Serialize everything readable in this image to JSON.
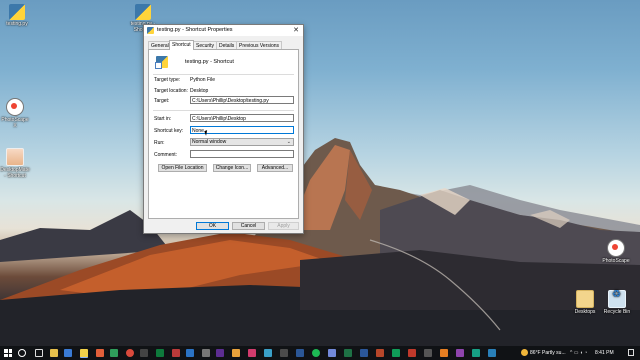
{
  "dialog": {
    "title": "testing.py - Shortcut Properties",
    "close_glyph": "✕",
    "tabs": [
      {
        "label": "General"
      },
      {
        "label": "Shortcut"
      },
      {
        "label": "Security"
      },
      {
        "label": "Details"
      },
      {
        "label": "Previous Versions"
      }
    ],
    "active_tab": "Shortcut",
    "shortcut_name": "testing.py - Shortcut",
    "target_type_label": "Target type:",
    "target_type_value": "Python File",
    "target_location_label": "Target location:",
    "target_location_value": "Desktop",
    "target_label": "Target:",
    "target_value": "C:\\Users\\Phillip\\Desktop\\testing.py",
    "start_in_label": "Start in:",
    "start_in_value": "C:\\Users\\Phillip\\Desktop",
    "shortcut_key_label": "Shortcut key:",
    "shortcut_key_value": "None",
    "run_label": "Run:",
    "run_value": "Normal window",
    "comment_label": "Comment:",
    "comment_value": "",
    "open_file_location_button": "Open File Location",
    "change_icon_button": "Change Icon...",
    "advanced_button": "Advanced...",
    "ok_button": "OK",
    "cancel_button": "Cancel",
    "apply_button": "Apply"
  },
  "desktop_icons": {
    "testing_py": "testing.py",
    "testing_shortcut": "testing.py - Shortcut",
    "photoscape_x": "PhotoScape X",
    "desktopmate": "DesktopMate - Shortcut",
    "photoscape": "PhotoScape",
    "desktops": "Desktops",
    "recycle_bin": "Recycle Bin"
  },
  "taskbar": {
    "weather": "86°F  Partly su...",
    "time": "8:41 PM",
    "tray_glyphs": "^ ▭ ◖ ◔"
  },
  "colors": {
    "accent": "#0078d7",
    "taskbar": "#101215",
    "dialog_bg": "#f0f0f0"
  }
}
